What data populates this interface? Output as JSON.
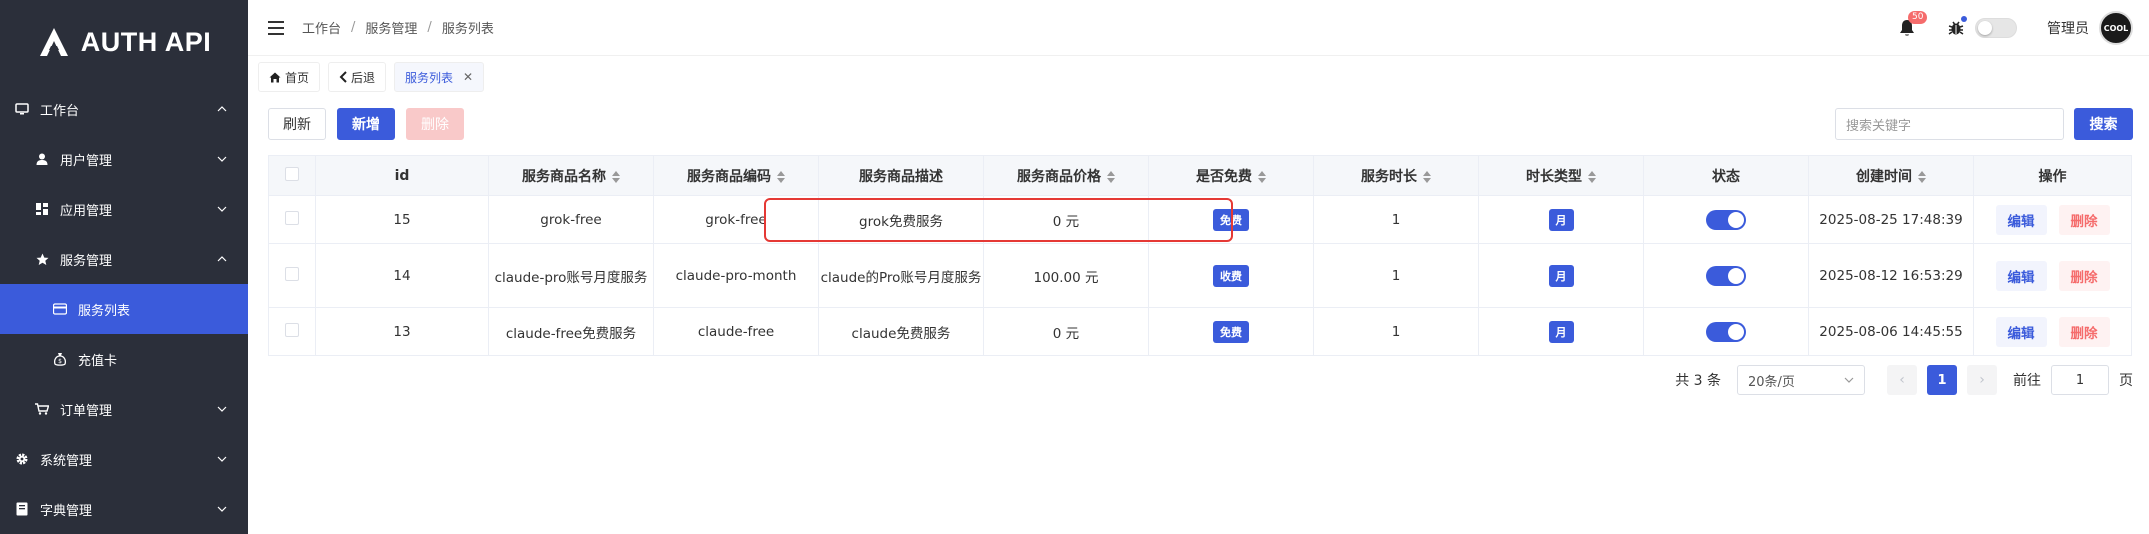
{
  "brand": {
    "name": "AUTH API"
  },
  "sidebar": {
    "items": [
      {
        "label": "工作台",
        "icon": "monitor-icon",
        "arrow": "up"
      },
      {
        "label": "用户管理",
        "icon": "user-icon",
        "arrow": "down"
      },
      {
        "label": "应用管理",
        "icon": "apps-icon",
        "arrow": "down"
      },
      {
        "label": "服务管理",
        "icon": "star-icon",
        "arrow": "up"
      },
      {
        "label": "服务列表",
        "icon": "card-icon",
        "active": true
      },
      {
        "label": "充值卡",
        "icon": "moneybag-icon"
      },
      {
        "label": "订单管理",
        "icon": "cart-icon",
        "arrow": "down"
      },
      {
        "label": "系统管理",
        "icon": "gear-icon",
        "arrow": "down"
      },
      {
        "label": "字典管理",
        "icon": "book-icon",
        "arrow": "down"
      }
    ]
  },
  "breadcrumb": [
    "工作台",
    "服务管理",
    "服务列表"
  ],
  "header": {
    "notification_count": "50",
    "username": "管理员",
    "avatar_text": "COOL"
  },
  "tabs": [
    {
      "label": "首页",
      "icon": "home-icon"
    },
    {
      "label": "后退",
      "icon": "back-icon"
    },
    {
      "label": "服务列表",
      "active": true
    }
  ],
  "toolbar": {
    "refresh_label": "刷新",
    "add_label": "新增",
    "delete_label": "删除"
  },
  "search": {
    "placeholder": "搜索关键字",
    "button_label": "搜索"
  },
  "table": {
    "columns": [
      "id",
      "服务商品名称",
      "服务商品编码",
      "服务商品描述",
      "服务商品价格",
      "是否免费",
      "服务时长",
      "时长类型",
      "状态",
      "创建时间",
      "操作"
    ],
    "rows": [
      {
        "id": "15",
        "name": "grok-free",
        "code": "grok-free",
        "desc": "grok免费服务",
        "price": "0 元",
        "free": "免费",
        "duration": "1",
        "duration_type": "月",
        "status": true,
        "created": "2025-08-25 17:48:39",
        "edit": "编辑",
        "delete": "删除"
      },
      {
        "id": "14",
        "name": "claude-pro账号月度服务",
        "code": "claude-pro-month",
        "desc": "claude的Pro账号月度服务",
        "price": "100.00 元",
        "free": "收费",
        "duration": "1",
        "duration_type": "月",
        "status": true,
        "created": "2025-08-12 16:53:29",
        "edit": "编辑",
        "delete": "删除"
      },
      {
        "id": "13",
        "name": "claude-free免费服务",
        "code": "claude-free",
        "desc": "claude免费服务",
        "price": "0 元",
        "free": "免费",
        "duration": "1",
        "duration_type": "月",
        "status": true,
        "created": "2025-08-06 14:45:55",
        "edit": "编辑",
        "delete": "删除"
      }
    ]
  },
  "pagination": {
    "total": "共 3 条",
    "page_size": "20条/页",
    "current_page": "1",
    "goto_label": "前往",
    "goto_value": "1",
    "page_suffix": "页"
  },
  "colors": {
    "accent": "#3b5bdb",
    "sidebar_bg": "#2b2f3a",
    "danger": "#f56c6c",
    "highlight": "#e53935"
  }
}
